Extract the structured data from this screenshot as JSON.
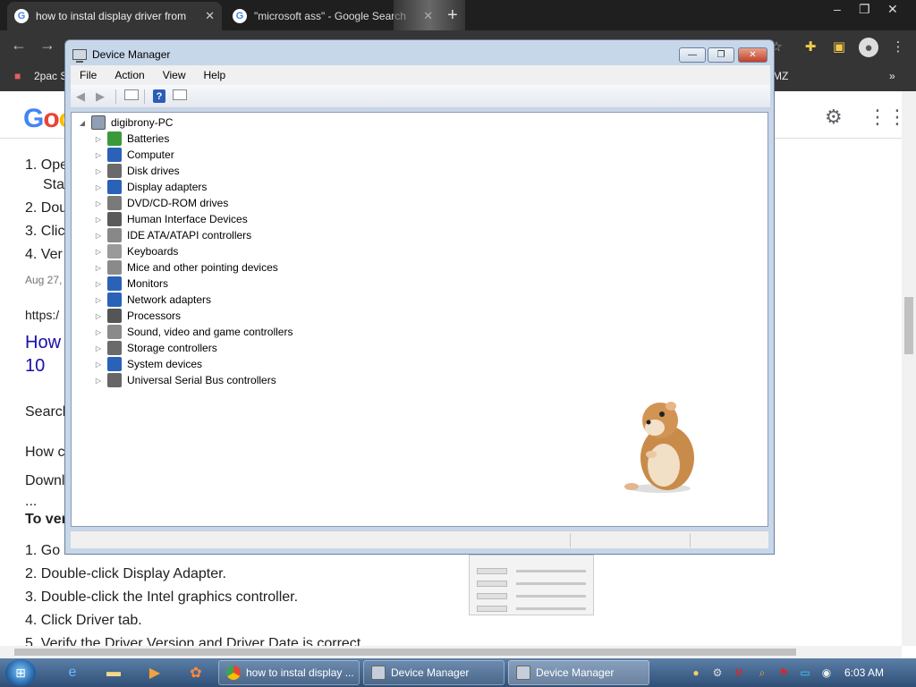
{
  "browser": {
    "tabs": [
      {
        "title": "how to instal display driver from"
      },
      {
        "title": "\"microsoft ass\" - Google Search"
      }
    ],
    "bookmarks": {
      "first": "2pac S",
      "last": "MZ"
    },
    "icons": [
      "back-arrow-icon",
      "forward-arrow-icon",
      "puzzle-icon",
      "profile-icon",
      "kebab-menu-icon"
    ]
  },
  "page": {
    "logo": [
      "G",
      "o",
      "o"
    ],
    "lines": [
      {
        "text": "1. Ope",
        "y": 0
      },
      {
        "text": "Sta"
      },
      {
        "text": "2. Dou"
      },
      {
        "text": "3. Clic"
      },
      {
        "text": "4. Ver"
      },
      {
        "text": "Aug 27,"
      },
      {
        "text": "https:/"
      },
      {
        "text": "How"
      },
      {
        "text": "10"
      },
      {
        "text": "Search"
      },
      {
        "text": "How c"
      },
      {
        "text": "Downl"
      },
      {
        "text": "..."
      },
      {
        "text": "To ver"
      },
      {
        "text": "1. Go"
      },
      {
        "text": "2. Double-click Display Adapter."
      },
      {
        "text": "3. Double-click the Intel graphics controller."
      },
      {
        "text": "4. Click Driver tab."
      },
      {
        "text": "5. Verify the Driver Version and Driver Date is correct."
      }
    ]
  },
  "device_manager": {
    "title": "Device Manager",
    "menu": [
      "File",
      "Action",
      "View",
      "Help"
    ],
    "root": "digibrony-PC",
    "categories": [
      {
        "label": "Batteries",
        "color": "#3a9a3a"
      },
      {
        "label": "Computer",
        "color": "#2a62b8"
      },
      {
        "label": "Disk drives",
        "color": "#6a6a6a"
      },
      {
        "label": "Display adapters",
        "color": "#2a62b8"
      },
      {
        "label": "DVD/CD-ROM drives",
        "color": "#7a7a7a"
      },
      {
        "label": "Human Interface Devices",
        "color": "#5a5a5a"
      },
      {
        "label": "IDE ATA/ATAPI controllers",
        "color": "#888888"
      },
      {
        "label": "Keyboards",
        "color": "#9a9a9a"
      },
      {
        "label": "Mice and other pointing devices",
        "color": "#8a8a8a"
      },
      {
        "label": "Monitors",
        "color": "#2a62b8"
      },
      {
        "label": "Network adapters",
        "color": "#2a62b8"
      },
      {
        "label": "Processors",
        "color": "#555555"
      },
      {
        "label": "Sound, video and game controllers",
        "color": "#8a8a8a"
      },
      {
        "label": "Storage controllers",
        "color": "#6a6a6a"
      },
      {
        "label": "System devices",
        "color": "#2a62b8"
      },
      {
        "label": "Universal Serial Bus controllers",
        "color": "#666666"
      }
    ]
  },
  "taskbar": {
    "buttons": [
      {
        "label": "how to instal display ..."
      },
      {
        "label": "Device Manager"
      },
      {
        "label": "Device Manager"
      }
    ],
    "clock": "6:03 AM"
  }
}
